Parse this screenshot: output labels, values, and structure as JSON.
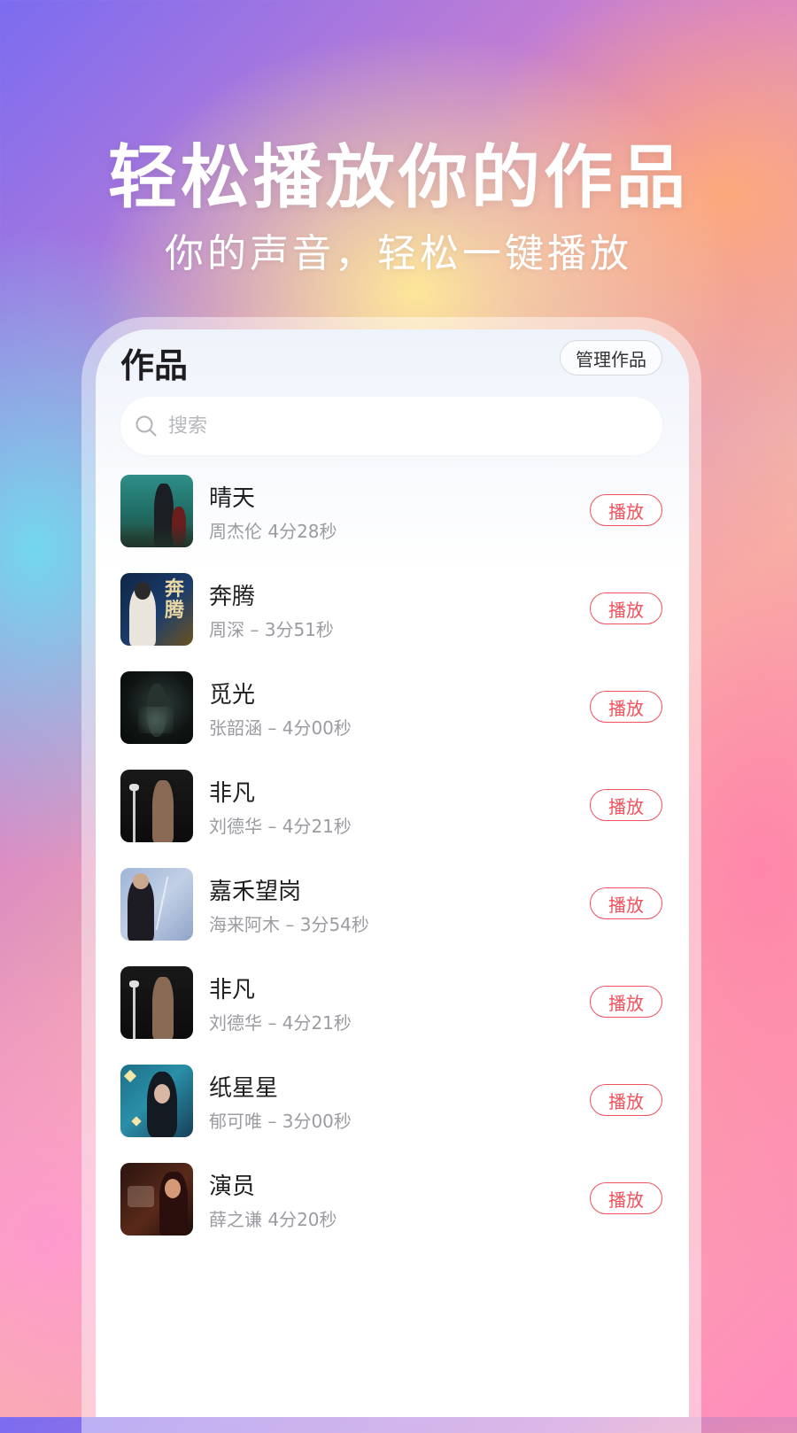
{
  "hero": {
    "title": "轻松播放你的作品",
    "subtitle": "你的声音，轻松一键播放"
  },
  "screen": {
    "title": "作品",
    "manage_label": "管理作品",
    "search_placeholder": "搜索"
  },
  "songs": [
    {
      "title": "晴天",
      "meta": "周杰伦 4分28秒",
      "play_label": "播放",
      "cover": "c1"
    },
    {
      "title": "奔腾",
      "meta": "周深 – 3分51秒",
      "play_label": "播放",
      "cover": "c2"
    },
    {
      "title": "觅光",
      "meta": "张韶涵 – 4分00秒",
      "play_label": "播放",
      "cover": "c3"
    },
    {
      "title": "非凡",
      "meta": "刘德华 – 4分21秒",
      "play_label": "播放",
      "cover": "c4"
    },
    {
      "title": "嘉禾望岗",
      "meta": "海来阿木 – 3分54秒",
      "play_label": "播放",
      "cover": "c5"
    },
    {
      "title": "非凡",
      "meta": "刘德华 – 4分21秒",
      "play_label": "播放",
      "cover": "c6"
    },
    {
      "title": "纸星星",
      "meta": "郁可唯 – 3分00秒",
      "play_label": "播放",
      "cover": "c7"
    },
    {
      "title": "演员",
      "meta": "薛之谦 4分20秒",
      "play_label": "播放",
      "cover": "c8"
    }
  ],
  "icons": {
    "search": "search-icon"
  },
  "colors": {
    "play_accent": "#f2515c",
    "meta_text": "#9a9ca1"
  }
}
